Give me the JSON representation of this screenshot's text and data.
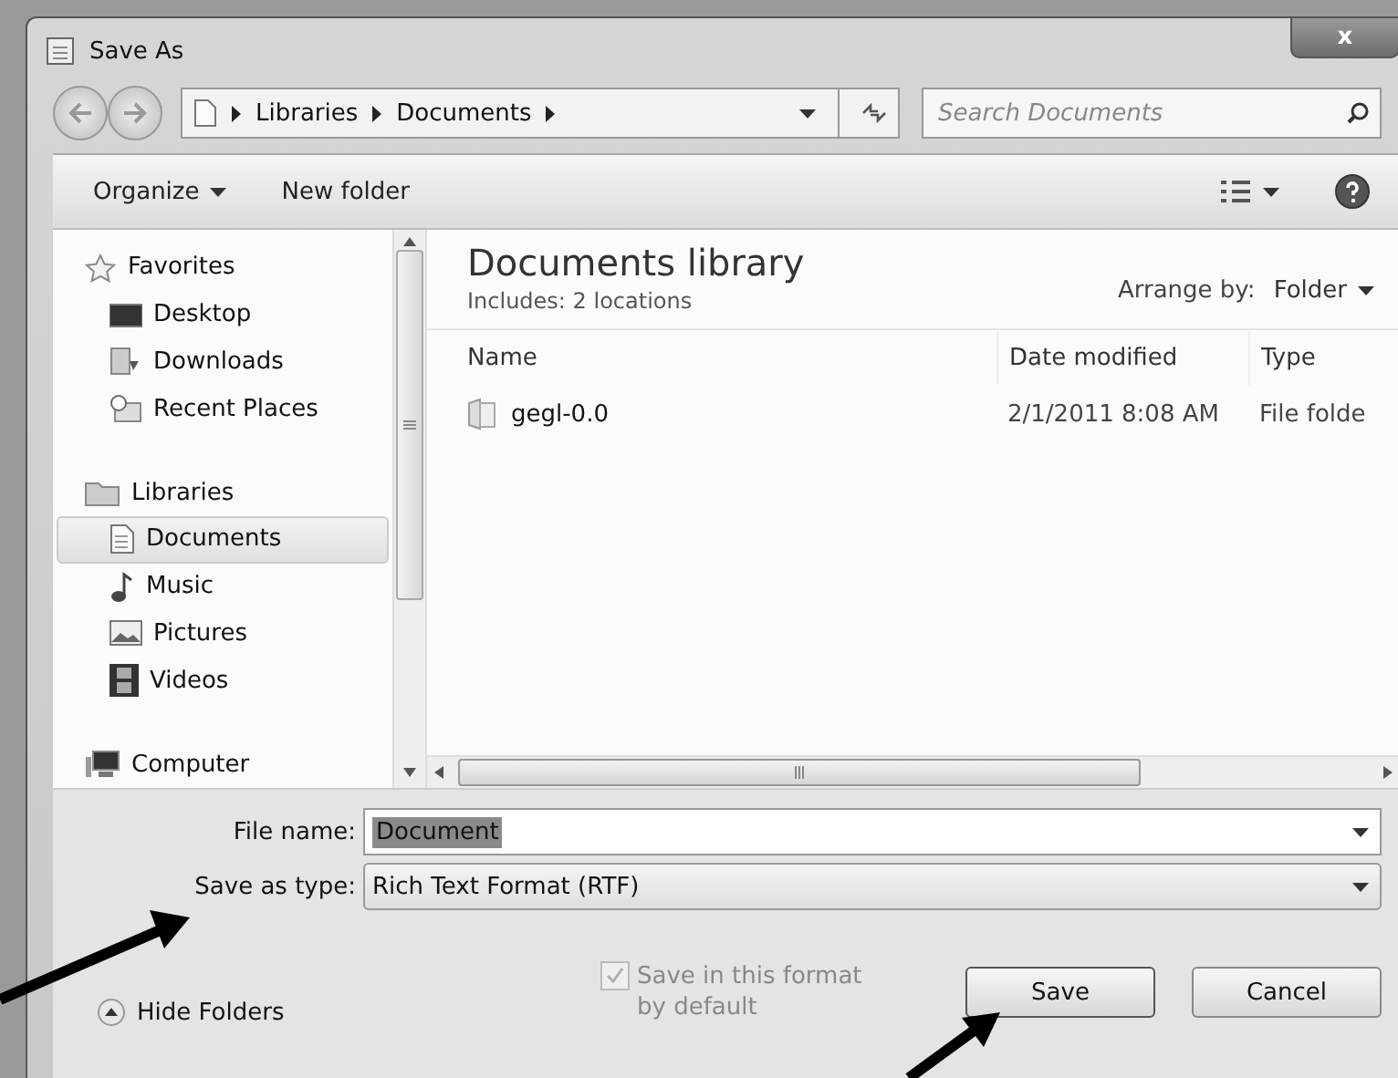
{
  "window": {
    "title": "Save As",
    "close": "x"
  },
  "address": {
    "crumbs": [
      "Libraries",
      "Documents"
    ],
    "search_placeholder": "Search Documents"
  },
  "toolbar": {
    "organize": "Organize",
    "new_folder": "New folder"
  },
  "sidebar": {
    "groups": [
      {
        "label": "Favorites",
        "selected": false,
        "children": [
          {
            "label": "Desktop",
            "selected": false
          },
          {
            "label": "Downloads",
            "selected": false
          },
          {
            "label": "Recent Places",
            "selected": false
          }
        ]
      },
      {
        "label": "Libraries",
        "selected": false,
        "children": [
          {
            "label": "Documents",
            "selected": true
          },
          {
            "label": "Music",
            "selected": false
          },
          {
            "label": "Pictures",
            "selected": false
          },
          {
            "label": "Videos",
            "selected": false
          }
        ]
      },
      {
        "label": "Computer",
        "selected": false
      }
    ]
  },
  "library": {
    "title": "Documents library",
    "subtitle": "Includes:  2 locations",
    "arrange_label": "Arrange by:",
    "arrange_value": "Folder"
  },
  "table": {
    "columns": [
      "Name",
      "Date modified",
      "Type"
    ],
    "rows": [
      {
        "name": "gegl-0.0",
        "date": "2/1/2011 8:08 AM",
        "type": "File folde"
      }
    ]
  },
  "form": {
    "file_name_label": "File name:",
    "file_name": "Document",
    "type_label": "Save as type:",
    "type_value": "Rich Text Format (RTF)"
  },
  "checkbox": {
    "label": "Save in this format by default",
    "checked": true,
    "disabled": true
  },
  "hide_folders": "Hide Folders",
  "buttons": [
    "Save",
    "Cancel"
  ]
}
